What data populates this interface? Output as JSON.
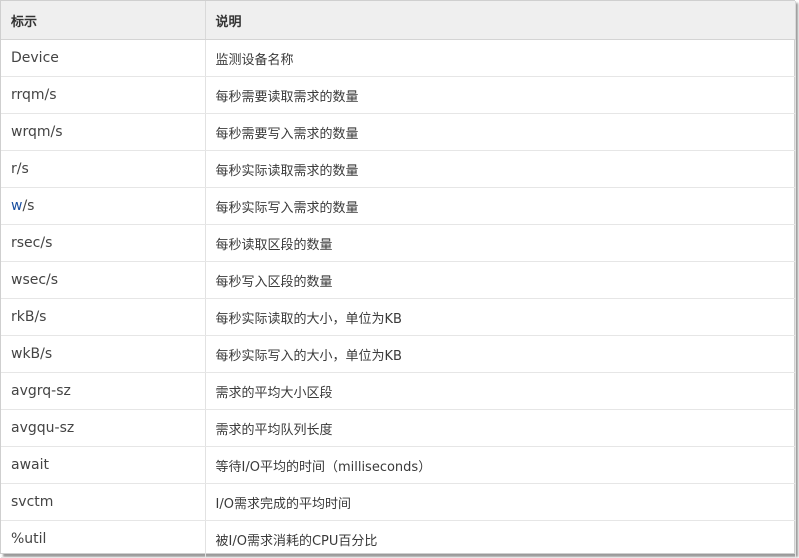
{
  "table": {
    "headers": [
      "标示",
      "说明"
    ],
    "rows": [
      {
        "name": "Device",
        "desc": "监测设备名称"
      },
      {
        "name": "rrqm/s",
        "desc": "每秒需要读取需求的数量"
      },
      {
        "name": "wrqm/s",
        "desc": "每秒需要写入需求的数量"
      },
      {
        "name": "r/s",
        "desc": "每秒实际读取需求的数量"
      },
      {
        "name_link": "w",
        "name_rest": "/s",
        "desc": "每秒实际写入需求的数量"
      },
      {
        "name": "rsec/s",
        "desc": "每秒读取区段的数量"
      },
      {
        "name": "wsec/s",
        "desc": "每秒写入区段的数量"
      },
      {
        "name": "rkB/s",
        "desc": "每秒实际读取的大小，单位为KB"
      },
      {
        "name": "wkB/s",
        "desc": "每秒实际写入的大小，单位为KB"
      },
      {
        "name": "avgrq-sz",
        "desc": "需求的平均大小区段"
      },
      {
        "name": "avgqu-sz",
        "desc": "需求的平均队列长度"
      },
      {
        "name": "await",
        "desc": "等待I/O平均的时间（milliseconds）"
      },
      {
        "name": "svctm",
        "desc": "I/O需求完成的平均时间"
      },
      {
        "name": "%util",
        "desc": "被I/O需求消耗的CPU百分比"
      }
    ]
  },
  "colors": {
    "header_bg": "#efefef",
    "link": "#1a4fa0",
    "border": "#e2e2e2"
  }
}
